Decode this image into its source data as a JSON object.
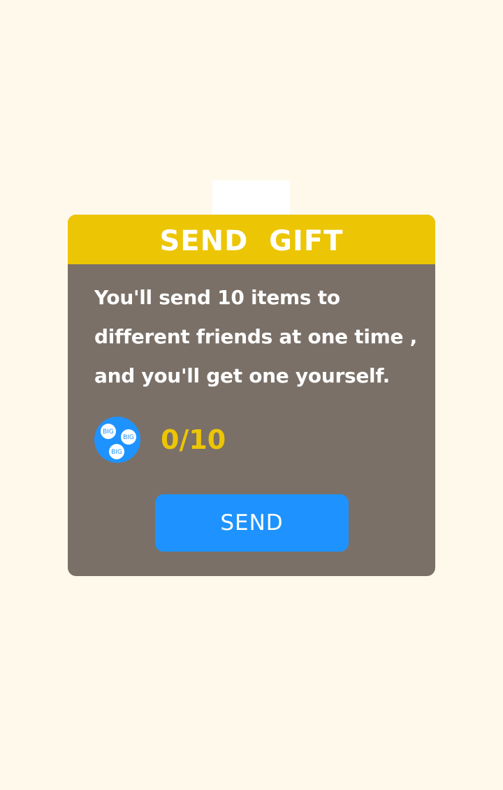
{
  "dialog": {
    "title": "SEND  GIFT",
    "message": "You'll send 10 items to different friends at one time , and you'll get one yourself.",
    "counter": "0/10",
    "coin_icon": "big-coins-icon",
    "coin_label": "BIG",
    "send_label": "SEND"
  },
  "colors": {
    "background": "#fef9ea",
    "header": "#ecc505",
    "panel": "#7a7067",
    "button": "#1e93ff",
    "counter": "#ecc505"
  }
}
